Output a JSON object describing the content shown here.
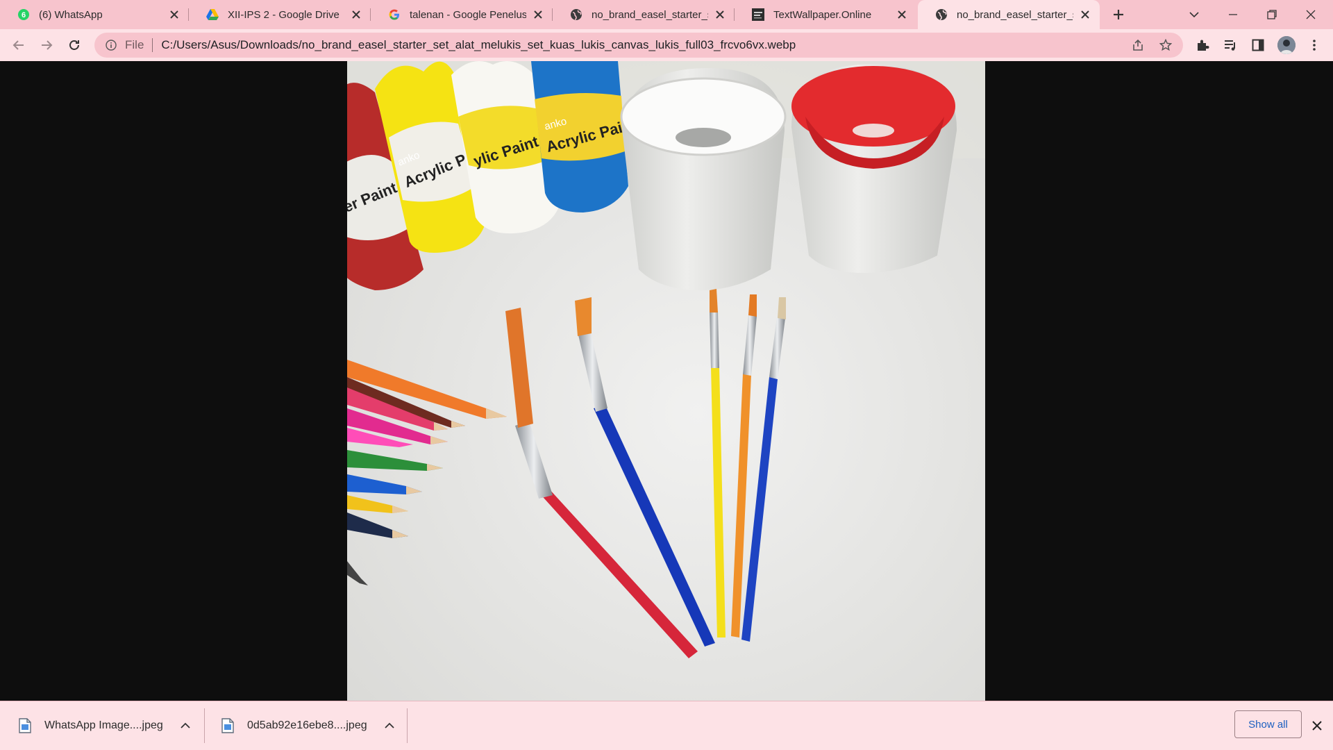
{
  "tabs": [
    {
      "title": "(6) WhatsApp",
      "icon": "whatsapp-icon",
      "active": false
    },
    {
      "title": "XII-IPS 2 - Google Drive",
      "icon": "google-drive-icon",
      "active": false
    },
    {
      "title": "talenan - Google Penelusuran",
      "icon": "google-icon",
      "active": false
    },
    {
      "title": "no_brand_easel_starter_set_alat_melukis",
      "icon": "globe-icon",
      "active": false
    },
    {
      "title": "TextWallpaper.Online",
      "icon": "textwallpaper-icon",
      "active": false
    },
    {
      "title": "no_brand_easel_starter_set_alat_melukis",
      "icon": "globe-icon",
      "active": true
    }
  ],
  "toolbar": {
    "scheme_label": "File",
    "url": "C:/Users/Asus/Downloads/no_brand_easel_starter_set_alat_melukis_set_kuas_lukis_canvas_lukis_full03_frcvo6vx.webp"
  },
  "photo": {
    "bottle_labels": [
      "er Paint",
      "Acrylic Paint",
      "ylic Paint",
      "Acrylic Paint"
    ],
    "brand_label": "anko"
  },
  "downloads": {
    "items": [
      {
        "name": "WhatsApp Image....jpeg"
      },
      {
        "name": "0d5ab92e16ebe8....jpeg"
      }
    ],
    "show_all_label": "Show all"
  },
  "colors": {
    "tabstrip": "#f7c4cd",
    "toolbar": "#fde2e6",
    "link": "#1a5fc0",
    "viewer_bg": "#0e0e0e"
  }
}
